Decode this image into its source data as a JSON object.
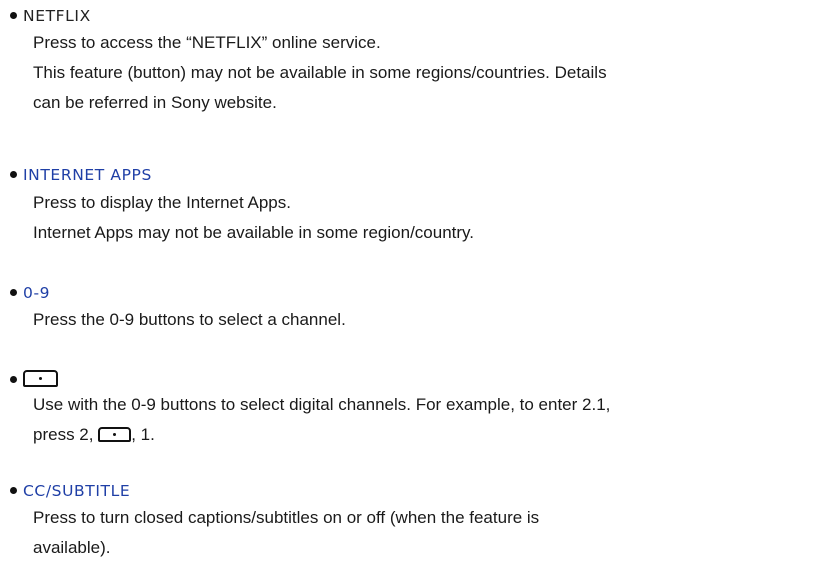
{
  "items": [
    {
      "heading": "NETFLIX",
      "lines": [
        "Press to access the “NETFLIX” online service.",
        "This feature (button) may not be available in some regions/countries. Details",
        "can be referred in Sony website."
      ]
    },
    {
      "heading": "INTERNET APPS",
      "lines": [
        "Press to display the Internet Apps.",
        "Internet Apps may not be available in some region/country."
      ]
    },
    {
      "heading": "0-9",
      "lines": [
        "Press the 0-9 buttons to select a channel."
      ]
    },
    {
      "heading_icon": "dot-button-icon",
      "lines": [
        "Use with the 0-9 buttons to select digital channels. For example, to enter 2.1,",
        "press 2, ",
        ", 1."
      ]
    },
    {
      "heading": "CC/SUBTITLE",
      "lines": [
        "Press to turn closed captions/subtitles on or off (when the feature is",
        "available)."
      ]
    }
  ],
  "colors": {
    "link": "#1f3fa6",
    "text": "#1a1a1a"
  }
}
